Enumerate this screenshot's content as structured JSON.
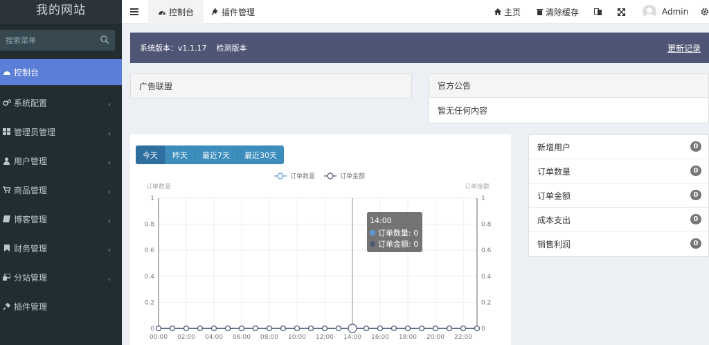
{
  "brand": "我的网站",
  "search": {
    "placeholder": "搜索菜单"
  },
  "menu": [
    {
      "label": "控制台",
      "active": true,
      "has_children": false
    },
    {
      "label": "系统配置",
      "active": false,
      "has_children": true
    },
    {
      "label": "管理员管理",
      "active": false,
      "has_children": true
    },
    {
      "label": "用户管理",
      "active": false,
      "has_children": true
    },
    {
      "label": "商品管理",
      "active": false,
      "has_children": true
    },
    {
      "label": "博客管理",
      "active": false,
      "has_children": true
    },
    {
      "label": "财务管理",
      "active": false,
      "has_children": true
    },
    {
      "label": "分站管理",
      "active": false,
      "has_children": true
    },
    {
      "label": "插件管理",
      "active": false,
      "has_children": false
    }
  ],
  "topbar": {
    "tab_dashboard": "控制台",
    "tab_plugins": "插件管理",
    "home": "主页",
    "clear_cache": "清除缓存",
    "user": "Admin"
  },
  "version": {
    "text": "系统版本：v1.1.17",
    "check": "检测版本",
    "changelog": "更新记录"
  },
  "panels": {
    "ads_title": "广告联盟",
    "notice_title": "官方公告",
    "notice_body": "暂无任何内容"
  },
  "range_buttons": [
    "今天",
    "昨天",
    "最近7天",
    "最近30天"
  ],
  "stats": [
    {
      "label": "新增用户",
      "value": "0"
    },
    {
      "label": "订单数量",
      "value": "0"
    },
    {
      "label": "订单金额",
      "value": "0"
    },
    {
      "label": "成本支出",
      "value": "0"
    },
    {
      "label": "销售利润",
      "value": "0"
    }
  ],
  "colors": {
    "accent": "#5b7fd9",
    "sidebar": "#222d32",
    "version_bar": "#4f5575",
    "btn": "#3c8dbc"
  },
  "chart_data": {
    "type": "line",
    "x": [
      "00:00",
      "01:00",
      "02:00",
      "03:00",
      "04:00",
      "05:00",
      "06:00",
      "07:00",
      "08:00",
      "09:00",
      "10:00",
      "11:00",
      "12:00",
      "13:00",
      "14:00",
      "15:00",
      "16:00",
      "17:00",
      "18:00",
      "19:00",
      "20:00",
      "21:00",
      "22:00",
      "23:00"
    ],
    "x_tick_labels": [
      "00:00",
      "02:00",
      "04:00",
      "06:00",
      "08:00",
      "10:00",
      "12:00",
      "14:00",
      "16:00",
      "18:00",
      "20:00",
      "22:00"
    ],
    "series": [
      {
        "name": "订单数量",
        "values": [
          0,
          0,
          0,
          0,
          0,
          0,
          0,
          0,
          0,
          0,
          0,
          0,
          0,
          0,
          0,
          0,
          0,
          0,
          0,
          0,
          0,
          0,
          0,
          0
        ],
        "color": "#5b9bd5"
      },
      {
        "name": "订单金额",
        "values": [
          0,
          0,
          0,
          0,
          0,
          0,
          0,
          0,
          0,
          0,
          0,
          0,
          0,
          0,
          0,
          0,
          0,
          0,
          0,
          0,
          0,
          0,
          0,
          0
        ],
        "color": "#4f5575"
      }
    ],
    "ylabel_left": "订单数量",
    "ylabel_right": "订单金额",
    "ylim": [
      0,
      1
    ],
    "yticks": [
      "0",
      "0.2",
      "0.4",
      "0.6",
      "0.8",
      "1"
    ],
    "legend": "top-center",
    "grid": true,
    "tooltip": {
      "title": "14:00",
      "lines": [
        "订单数量: 0",
        "订单金额: 0"
      ]
    }
  }
}
